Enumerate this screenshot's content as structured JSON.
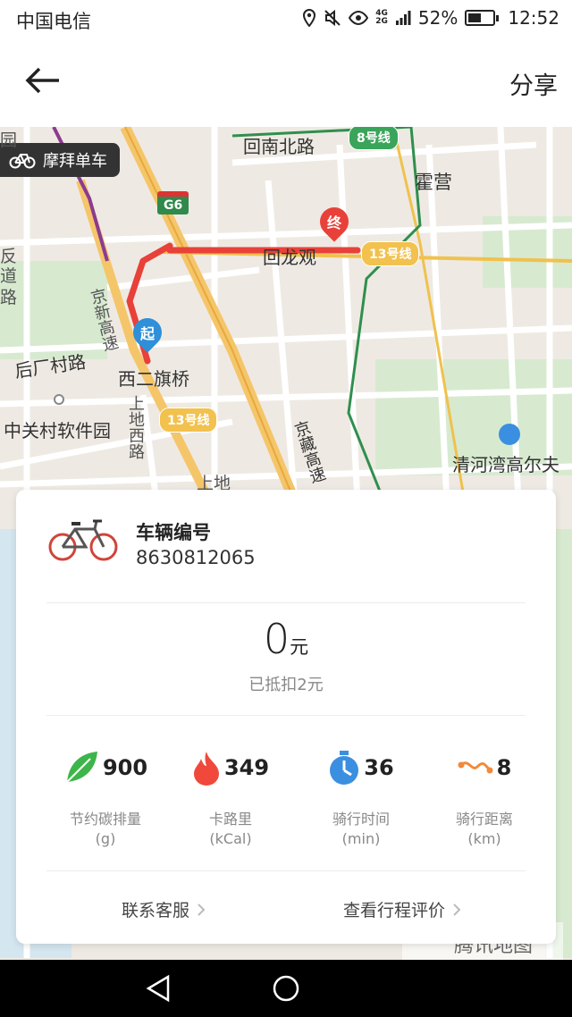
{
  "status_bar": {
    "carrier": "中国电信",
    "network_top": "4G",
    "network_bottom": "2G",
    "battery": "52%",
    "battery_level": 0.52,
    "time": "12:52"
  },
  "navbar": {
    "share_label": "分享"
  },
  "map": {
    "brand_badge": "摩拜单车",
    "labels": {
      "huinan_north_road": "回南北路",
      "huoying": "霍营",
      "huilongguan": "回龙观",
      "jingxin_expressway": "京新高速",
      "houchangcun_road": "后厂村路",
      "xierqi_bridge": "西二旗桥",
      "zhongguancun_software_park": "中关村软件园",
      "shangdi_west_road": "上地西路",
      "shangdi": "上地",
      "jingzang_expressway": "京藏高速",
      "qinghe_bay_golf": "清河湾高尔夫",
      "left_edge_1": "园",
      "left_edge_2": "反",
      "left_edge_3": "道",
      "left_edge_4": "路",
      "g6": "G6",
      "line8": "8号线",
      "line13_east": "13号线",
      "line13_south": "13号线",
      "tencent_map": "腾讯地图"
    },
    "start_marker": "起",
    "end_marker": "终"
  },
  "trip": {
    "vehicle_label": "车辆编号",
    "vehicle_number": "8630812065",
    "price_amount": "0",
    "price_unit": "元",
    "deducted": "已抵扣2元",
    "stats": [
      {
        "icon": "leaf-icon",
        "value": "900",
        "label": "节约碳排量",
        "unit": "(g)"
      },
      {
        "icon": "flame-icon",
        "value": "349",
        "label": "卡路里",
        "unit": "(kCal)"
      },
      {
        "icon": "timer-icon",
        "value": "36",
        "label": "骑行时间",
        "unit": "(min)"
      },
      {
        "icon": "route-icon",
        "value": "8",
        "label": "骑行距离",
        "unit": "(km)"
      }
    ],
    "contact_support": "联系客服",
    "view_trip_review": "查看行程评价"
  },
  "colors": {
    "route": "#e8413a",
    "start_marker": "#2f8fd8",
    "end_marker": "#e8413a",
    "leaf": "#3db54a",
    "flame": "#f0493b",
    "timer": "#3b8fe0",
    "route_icon": "#f08a3a"
  }
}
